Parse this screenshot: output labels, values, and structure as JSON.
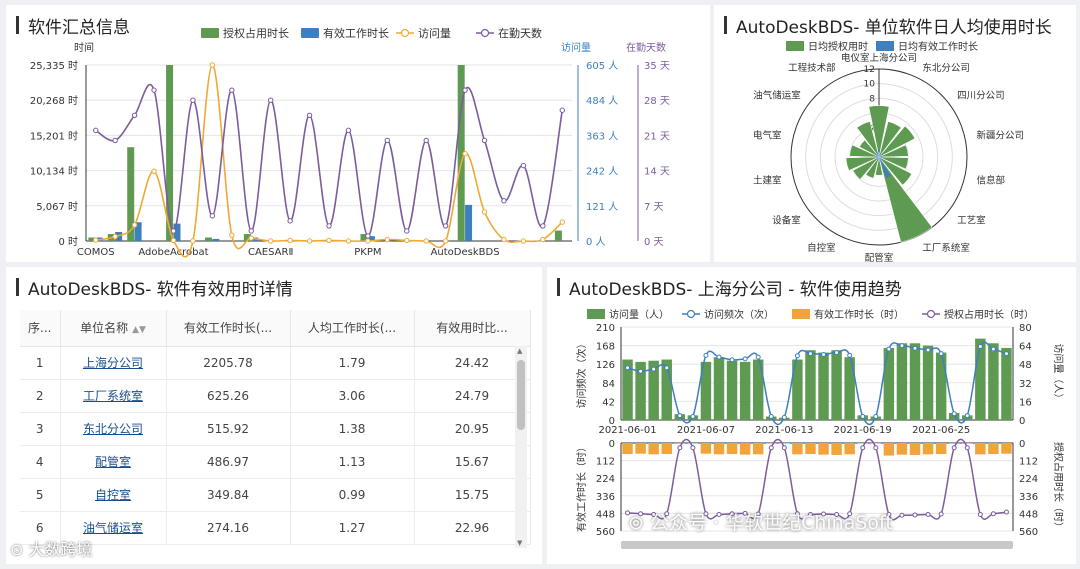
{
  "panels": {
    "summary": {
      "title": "软件汇总信息"
    },
    "polar": {
      "title": "AutoDeskBDS- 单位软件日人均使用时长"
    },
    "table": {
      "title": "AutoDeskBDS- 软件有效用时详情"
    },
    "trend": {
      "title": "AutoDeskBDS- 上海分公司 - 软件使用趋势"
    }
  },
  "table": {
    "headers": [
      "序...",
      "单位名称",
      "有效工作时长(...",
      "人均工作时长(...",
      "有效用时比..."
    ],
    "rows": [
      {
        "no": "1",
        "unit": "上海分公司",
        "effective": "2205.78",
        "per_capita": "1.79",
        "ratio": "24.42"
      },
      {
        "no": "2",
        "unit": "工厂系统室",
        "effective": "625.26",
        "per_capita": "3.06",
        "ratio": "24.79"
      },
      {
        "no": "3",
        "unit": "东北分公司",
        "effective": "515.92",
        "per_capita": "1.38",
        "ratio": "20.95"
      },
      {
        "no": "4",
        "unit": "配管室",
        "effective": "486.97",
        "per_capita": "1.13",
        "ratio": "15.67"
      },
      {
        "no": "5",
        "unit": "自控室",
        "effective": "349.84",
        "per_capita": "0.99",
        "ratio": "15.75"
      },
      {
        "no": "6",
        "unit": "油气储运室",
        "effective": "274.16",
        "per_capita": "1.27",
        "ratio": "22.96"
      }
    ]
  },
  "watermark": {
    "left": "大数跨境",
    "right": "公众号 · 华软世纪ChinaSoft"
  },
  "colors": {
    "green": "#5e9a52",
    "blue": "#3d7fbf",
    "orange": "#f0a833",
    "purple": "#7b5c9e",
    "orange_bar": "#f2a33a"
  },
  "chart_data": [
    {
      "type": "bar",
      "title": "软件汇总信息",
      "legend": [
        "授权占用时长",
        "有效工作时长",
        "访问量",
        "在勤天数"
      ],
      "legend_position": "top",
      "axis_labels": {
        "left": "时间",
        "right1": "访问量",
        "right2": "在勤天数"
      },
      "y_left_ticks": [
        "25,335 时",
        "20,268 时",
        "15,201 时",
        "10,134 时",
        "5,067 时",
        "0 时"
      ],
      "y_right1_ticks": [
        "605 人",
        "484 人",
        "363 人",
        "242 人",
        "121 人",
        "0 人"
      ],
      "y_right2_ticks": [
        "35 天",
        "28 天",
        "21 天",
        "14 天",
        "7 天",
        "0 天"
      ],
      "ylim": [
        0,
        25335
      ],
      "x_labels_shown": [
        "COMOS",
        "AdobeAcrobat",
        "CAESARⅡ",
        "PKPM",
        "AutoDeskBDS"
      ],
      "series": [
        {
          "name": "授权占用时长",
          "kind": "bar",
          "axis": "left",
          "values": [
            500,
            1000,
            13500,
            0,
            25335,
            0,
            500,
            0,
            1000,
            0,
            0,
            0,
            0,
            0,
            1000,
            0,
            0,
            0,
            0,
            25335,
            0,
            0,
            0,
            0,
            1500
          ]
        },
        {
          "name": "有效工作时长",
          "kind": "bar",
          "axis": "left",
          "values": [
            500,
            1300,
            2700,
            0,
            2500,
            0,
            300,
            0,
            500,
            0,
            0,
            0,
            0,
            0,
            700,
            0,
            0,
            0,
            0,
            5200,
            0,
            0,
            0,
            0,
            0
          ]
        },
        {
          "name": "访问量",
          "kind": "line",
          "axis": "right1",
          "values": [
            3,
            15,
            55,
            240,
            2,
            0,
            605,
            20,
            10,
            0,
            2,
            0,
            2,
            0,
            0,
            5,
            2,
            0,
            0,
            300,
            100,
            5,
            0,
            5,
            65
          ]
        },
        {
          "name": "在勤天数",
          "kind": "line",
          "axis": "right2",
          "values": [
            22,
            20,
            25,
            30,
            2,
            28,
            5,
            30,
            2,
            28,
            4,
            25,
            3,
            22,
            1,
            20,
            2,
            20,
            3,
            30,
            20,
            8,
            15,
            3,
            26
          ]
        }
      ]
    },
    {
      "type": "polar-bar",
      "title": "AutoDeskBDS- 单位软件日人均使用时长",
      "legend": [
        "日均授权用时",
        "日均有效工作时长"
      ],
      "legend_position": "top",
      "radial_ticks": [
        "0",
        "2",
        "4",
        "6",
        "8",
        "10",
        "12"
      ],
      "rmax": 12,
      "categories": [
        "电仪室上海分公司",
        "东北分公司",
        "四川分公司",
        "新疆分公司",
        "信息部",
        "工艺室",
        "工厂系统室",
        "配管室",
        "自控室",
        "设备室",
        "土建室",
        "电气室",
        "油气储运室",
        "工程技术部"
      ],
      "series": [
        {
          "name": "日均授权用时",
          "values": [
            7,
            5,
            5.5,
            4,
            4,
            5,
            12,
            2.5,
            3,
            4,
            4.5,
            4,
            3,
            5
          ]
        },
        {
          "name": "日均有效工作时长",
          "values": [
            1,
            0.5,
            0.6,
            0.5,
            0.4,
            0.8,
            3,
            0.5,
            0.5,
            0.6,
            0.4,
            0.5,
            0.6,
            0.8
          ]
        }
      ]
    },
    {
      "type": "bar",
      "title": "AutoDeskBDS- 上海分公司 - 软件使用趋势",
      "legend": [
        "访问量（人）",
        "访问频次（次）",
        "有效工作时长（时）",
        "授权占用时长（时）"
      ],
      "legend_position": "top",
      "x": [
        "2021-06-01",
        "2021-06-02",
        "2021-06-03",
        "2021-06-04",
        "2021-06-05",
        "2021-06-06",
        "2021-06-07",
        "2021-06-08",
        "2021-06-09",
        "2021-06-10",
        "2021-06-11",
        "2021-06-12",
        "2021-06-13",
        "2021-06-14",
        "2021-06-15",
        "2021-06-16",
        "2021-06-17",
        "2021-06-18",
        "2021-06-19",
        "2021-06-20",
        "2021-06-21",
        "2021-06-22",
        "2021-06-23",
        "2021-06-24",
        "2021-06-25",
        "2021-06-26",
        "2021-06-27",
        "2021-06-28",
        "2021-06-29",
        "2021-06-30"
      ],
      "x_ticks_shown": [
        "2021-06-01",
        "2021-06-07",
        "2021-06-13",
        "2021-06-19",
        "2021-06-25"
      ],
      "top": {
        "left_axis_label": "访问频次（次）",
        "right_axis_label": "访问量（人）",
        "left_ticks": [
          "210",
          "168",
          "126",
          "84",
          "42",
          "0"
        ],
        "right_ticks": [
          "80",
          "64",
          "48",
          "32",
          "16",
          "0"
        ],
        "left_ylim": [
          0,
          210
        ],
        "right_ylim": [
          0,
          80
        ],
        "series": [
          {
            "name": "访问量（人）",
            "kind": "bar",
            "axis": "right",
            "values": [
              52,
              50,
              51,
              52,
              5,
              4,
              50,
              54,
              51,
              50,
              52,
              3,
              2,
              52,
              60,
              58,
              60,
              54,
              4,
              3,
              62,
              66,
              66,
              64,
              58,
              6,
              4,
              70,
              66,
              62
            ]
          },
          {
            "name": "访问频次（次）",
            "kind": "line",
            "axis": "left",
            "values": [
              118,
              110,
              115,
              118,
              10,
              8,
              146,
              142,
              136,
              138,
              142,
              8,
              6,
              145,
              150,
              148,
              152,
              146,
              8,
              8,
              160,
              168,
              162,
              158,
              150,
              14,
              10,
              166,
              160,
              150
            ]
          }
        ]
      },
      "bottom": {
        "left_axis_label": "有效工作时长（时）",
        "right_axis_label": "授权占用时长（时）",
        "left_ticks": [
          "0",
          "112",
          "224",
          "336",
          "448",
          "560"
        ],
        "right_ticks": [
          "0",
          "112",
          "224",
          "336",
          "448",
          "560"
        ],
        "ylim": [
          0,
          560
        ],
        "inverted": true,
        "series": [
          {
            "name": "有效工作时长（时）",
            "kind": "bar",
            "axis": "left",
            "values": [
              70,
              68,
              72,
              70,
              5,
              4,
              68,
              72,
              70,
              74,
              72,
              4,
              3,
              72,
              70,
              74,
              76,
              72,
              4,
              3,
              80,
              74,
              76,
              72,
              70,
              5,
              4,
              72,
              70,
              68
            ]
          },
          {
            "name": "授权占用时长（时）",
            "kind": "line",
            "axis": "right",
            "values": [
              445,
              450,
              455,
              450,
              30,
              30,
              450,
              455,
              450,
              448,
              452,
              30,
              30,
              450,
              455,
              452,
              455,
              450,
              30,
              30,
              455,
              460,
              458,
              455,
              452,
              30,
              30,
              455,
              450,
              440
            ]
          }
        ]
      }
    }
  ]
}
